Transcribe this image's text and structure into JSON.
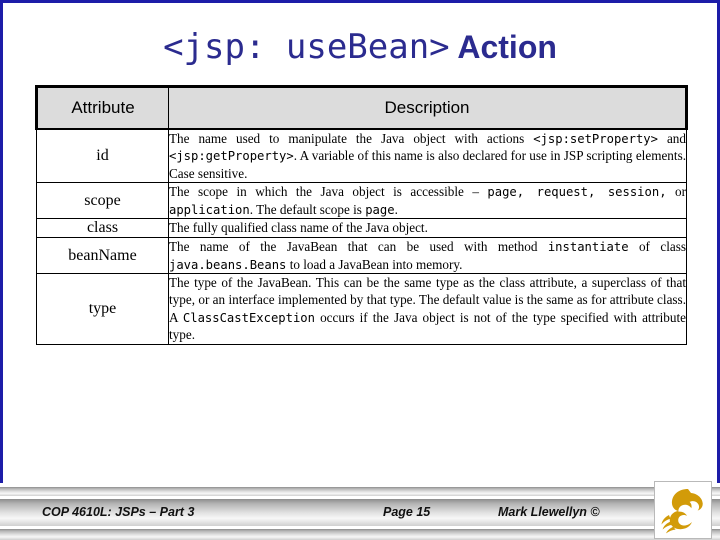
{
  "slide": {
    "title_code": "<jsp: useBean>",
    "title_word": " Action",
    "border_color": "#1d1da8",
    "title_color": "#2b2b8f"
  },
  "table": {
    "headers": [
      "Attribute",
      "Description"
    ],
    "header_bg": "#dcdcdc",
    "rows": [
      {
        "attribute": "id",
        "description_parts": [
          {
            "text": "The name used to manipulate the Java object with actions ",
            "style": "serif"
          },
          {
            "text": "<jsp:setProperty>",
            "style": "mono"
          },
          {
            "text": " and ",
            "style": "serif"
          },
          {
            "text": "<jsp:getProperty>",
            "style": "mono"
          },
          {
            "text": ".  A variable of this name is also declared for use in JSP scripting elements.  Case sensitive.",
            "style": "serif"
          }
        ]
      },
      {
        "attribute": "scope",
        "description_parts": [
          {
            "text": "The scope in which the Java object is accessible – ",
            "style": "serif"
          },
          {
            "text": "page, request, session,",
            "style": "mono"
          },
          {
            "text": " or ",
            "style": "serif"
          },
          {
            "text": "application",
            "style": "mono"
          },
          {
            "text": ". The default scope is ",
            "style": "serif"
          },
          {
            "text": "page",
            "style": "mono"
          },
          {
            "text": ".",
            "style": "serif"
          }
        ]
      },
      {
        "attribute": "class",
        "description_parts": [
          {
            "text": "The fully qualified class name of the Java object.",
            "style": "serif"
          }
        ]
      },
      {
        "attribute": "beanName",
        "description_parts": [
          {
            "text": "The name of the JavaBean that can be used with method ",
            "style": "serif"
          },
          {
            "text": "instantiate",
            "style": "mono"
          },
          {
            "text": " of class ",
            "style": "serif"
          },
          {
            "text": "java.beans.Beans",
            "style": "mono"
          },
          {
            "text": " to load a JavaBean into memory.",
            "style": "serif"
          }
        ]
      },
      {
        "attribute": "type",
        "description_parts": [
          {
            "text": "The type of the JavaBean.  This can be the same type as the class attribute, a superclass of that type, or an interface implemented by that type.  The default value is the same as for attribute class.  A ",
            "style": "serif"
          },
          {
            "text": "ClassCastException",
            "style": "mono"
          },
          {
            "text": " occurs if the Java object is not of the type specified with attribute type.",
            "style": "serif"
          }
        ]
      }
    ]
  },
  "footer": {
    "course": "COP 4610L: JSPs – Part 3",
    "page": "Page 15",
    "author": "Mark Llewellyn ©",
    "logo_name": "ucf-pegasus-logo",
    "logo_color": "#d29b09"
  }
}
